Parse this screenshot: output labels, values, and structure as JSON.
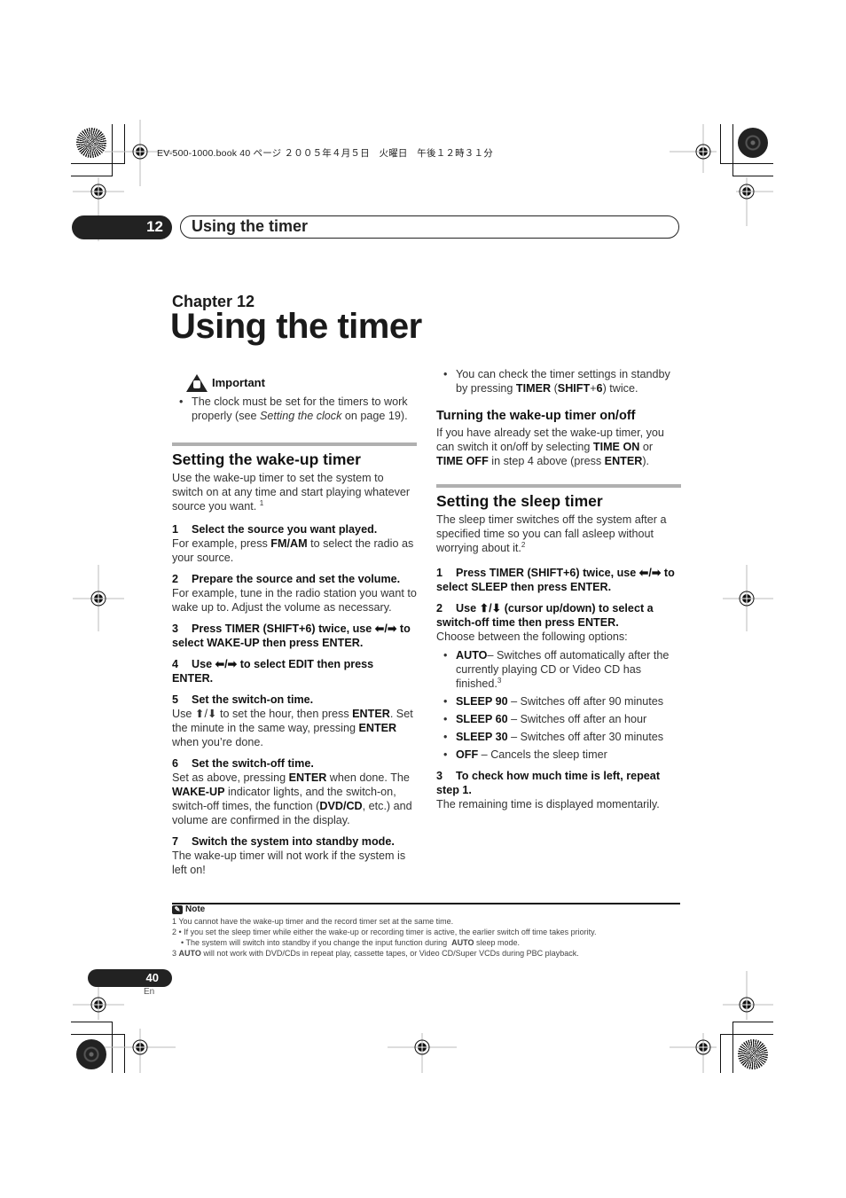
{
  "print_info": "EV-500-1000.book  40 ページ  ２００５年４月５日　火曜日　午後１２時３１分",
  "header": {
    "chapter_number": "12",
    "chapter_title": "Using the timer"
  },
  "chapter_label": "Chapter 12",
  "page_title": "Using the timer",
  "important": {
    "icon": "warning-hand-icon",
    "label": "Important",
    "text_before": "The clock must be set for the timers to work properly (see ",
    "link_text": "Setting the clock",
    "text_after": " on page 19)."
  },
  "wakeup": {
    "title": "Setting the wake-up timer",
    "intro": "Use the wake-up timer to set the system to switch on at any time and start playing whatever source you want.",
    "intro_note": "1",
    "steps": [
      {
        "num": "1",
        "head": "Select the source you want played.",
        "body_pre": "For example, press ",
        "body_bold": "FM/AM",
        "body_post": " to select the radio as your source."
      },
      {
        "num": "2",
        "head": "Prepare the source and set the volume.",
        "body": "For example, tune in the radio station you want to wake up to. Adjust the volume as necessary."
      },
      {
        "num": "3",
        "head": "Press TIMER (SHIFT+6) twice, use ⬅/➡ to select WAKE-UP then press ENTER."
      },
      {
        "num": "4",
        "head": "Use ⬅/➡ to select EDIT then press ENTER."
      },
      {
        "num": "5",
        "head": "Set the switch-on time.",
        "b1": "Use ⬆/⬇ to set the hour, then press ",
        "b2": "ENTER",
        "b3": ". Set the minute in the same way, pressing ",
        "b4": "ENTER",
        "b5": " when you’re done."
      },
      {
        "num": "6",
        "head": "Set the switch-off time.",
        "b1": "Set as above, pressing ",
        "b2": "ENTER",
        "b3": " when done. The ",
        "b4": "WAKE-UP",
        "b5": " indicator lights, and the switch-on, switch-off times, the function (",
        "b6": "DVD/CD",
        "b7": ", etc.) and volume are confirmed in the display."
      },
      {
        "num": "7",
        "head": "Switch the system into standby mode.",
        "body": "The wake-up timer will not work if the system is left on!"
      }
    ]
  },
  "check_tip": {
    "b1": "You can check the timer settings in standby by pressing ",
    "b2": "TIMER",
    "b3": " (",
    "b4": "SHIFT",
    "b5": "+",
    "b6": "6",
    "b7": ") twice."
  },
  "onoff": {
    "title": "Turning the wake-up timer on/off",
    "b1": "If you have already set the wake-up timer, you can switch it on/off by selecting ",
    "b2": "TIME ON",
    "b3": " or ",
    "b4": "TIME OFF",
    "b5": " in step 4 above (press ",
    "b6": "ENTER",
    "b7": ")."
  },
  "sleep": {
    "title": "Setting the sleep timer",
    "intro": "The sleep timer switches off the system after a specified time so you can fall asleep without worrying about it.",
    "intro_note": "2",
    "step1": {
      "num": "1",
      "head": "Press TIMER (SHIFT+6) twice, use ⬅/➡ to select SLEEP then press ENTER."
    },
    "step2": {
      "num": "2",
      "head": "Use ⬆/⬇ (cursor up/down) to select a switch-off time then press ENTER.",
      "body": "Choose between the following options:"
    },
    "options": [
      {
        "key": "AUTO",
        "desc": "– Switches off automatically after the currently playing CD or Video CD has finished.",
        "note": "3"
      },
      {
        "key": "SLEEP 90",
        "desc": " – Switches off after 90 minutes"
      },
      {
        "key": "SLEEP 60",
        "desc": " – Switches off after an hour"
      },
      {
        "key": "SLEEP 30",
        "desc": " – Switches off after 30 minutes"
      },
      {
        "key": "OFF",
        "desc": " – Cancels the sleep timer"
      }
    ],
    "step3": {
      "num": "3",
      "head": "To check how much time is left, repeat step 1.",
      "body": "The remaining time is displayed momentarily."
    }
  },
  "notes": {
    "label": "Note",
    "n1": "1 You cannot have the wake-up timer and the record timer set at the same time.",
    "n2a": "2  • If you set the sleep timer while either the wake-up or recording timer is active, the earlier switch off time takes priority.",
    "n2b_pre": "    • The system will switch into standby if you change the input function during  ",
    "n2b_bold": "AUTO",
    "n2b_post": " sleep mode.",
    "n3_pre": "3 ",
    "n3_bold": "AUTO",
    "n3_post": " will not work with DVD/CDs in repeat play, cassette tapes, or Video CD/Super VCDs during PBC playback."
  },
  "footer": {
    "page_number": "40",
    "language": "En"
  }
}
